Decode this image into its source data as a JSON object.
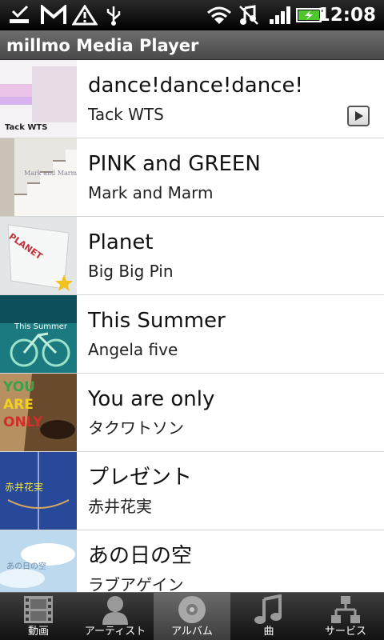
{
  "status_bar": {
    "time": "12:08",
    "icons": [
      "download-done-icon",
      "gmail-icon",
      "warning-icon",
      "usb-icon",
      "wifi-icon",
      "vibrate-off-icon",
      "signal-icon",
      "battery-charging-icon"
    ]
  },
  "app": {
    "title": "millmo Media Player"
  },
  "albums": [
    {
      "title": "dance!dance!dance!",
      "artist": "Tack WTS",
      "cover_text": "Tack WTS"
    },
    {
      "title": "PINK and GREEN",
      "artist": "Mark and Marm",
      "cover_text": "Mark and Marm"
    },
    {
      "title": "Planet",
      "artist": "Big Big Pin",
      "cover_text": "PLANET"
    },
    {
      "title": "This Summer",
      "artist": "Angela five",
      "cover_text": "This Summer"
    },
    {
      "title": "You are only",
      "artist": "タクワトソン",
      "cover_text": [
        "YOU",
        "ARE",
        "ONLY"
      ]
    },
    {
      "title": "プレゼント",
      "artist": "赤井花実",
      "cover_text": "赤井花実"
    },
    {
      "title": "あの日の空",
      "artist": "ラブアゲイン",
      "cover_text": "あの日の空"
    }
  ],
  "tabs": [
    {
      "label": "動画",
      "icon": "film-icon",
      "selected": false
    },
    {
      "label": "アーティスト",
      "icon": "person-icon",
      "selected": false
    },
    {
      "label": "アルバム",
      "icon": "disc-icon",
      "selected": true
    },
    {
      "label": "曲",
      "icon": "music-note-icon",
      "selected": false
    },
    {
      "label": "サービス",
      "icon": "network-icon",
      "selected": false
    }
  ],
  "colors": {
    "title_bar": "#5a5a5a",
    "status_bar": "#000000",
    "tab_selected": "#5a5a5a"
  }
}
